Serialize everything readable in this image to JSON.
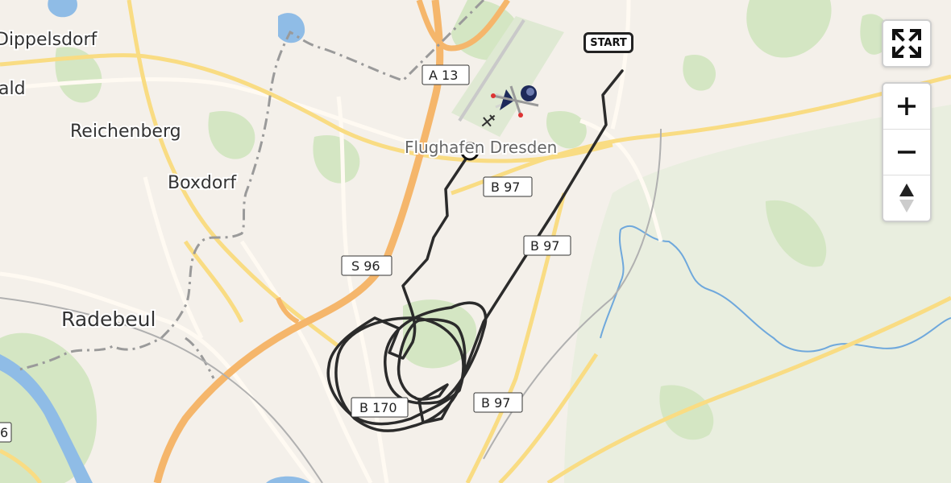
{
  "map": {
    "places": [
      {
        "id": "dippelsdorf",
        "label": "Dippelsdorf"
      },
      {
        "id": "wald",
        "label": "ald"
      },
      {
        "id": "reichenberg",
        "label": "Reichenberg"
      },
      {
        "id": "boxdorf",
        "label": "Boxdorf"
      },
      {
        "id": "radebeul",
        "label": "Radebeul"
      },
      {
        "id": "flughafen",
        "label": "Flughafen Dresden"
      }
    ],
    "roads": [
      "A 13",
      "B 97",
      "B 97",
      "S 96",
      "B 170",
      "B 97",
      "6"
    ],
    "start_label": "START",
    "colors": {
      "track": "#2b2b2b",
      "water": "#6fa8dc",
      "forest": "#cfe3bd",
      "motorway": "#f5b66b",
      "border": "#9a9a9a"
    }
  },
  "controls": {
    "fullscreen_icon": "fullscreen-icon",
    "zoom_in_icon": "plus-icon",
    "zoom_out_icon": "minus-icon",
    "compass_icon": "compass-icon"
  }
}
